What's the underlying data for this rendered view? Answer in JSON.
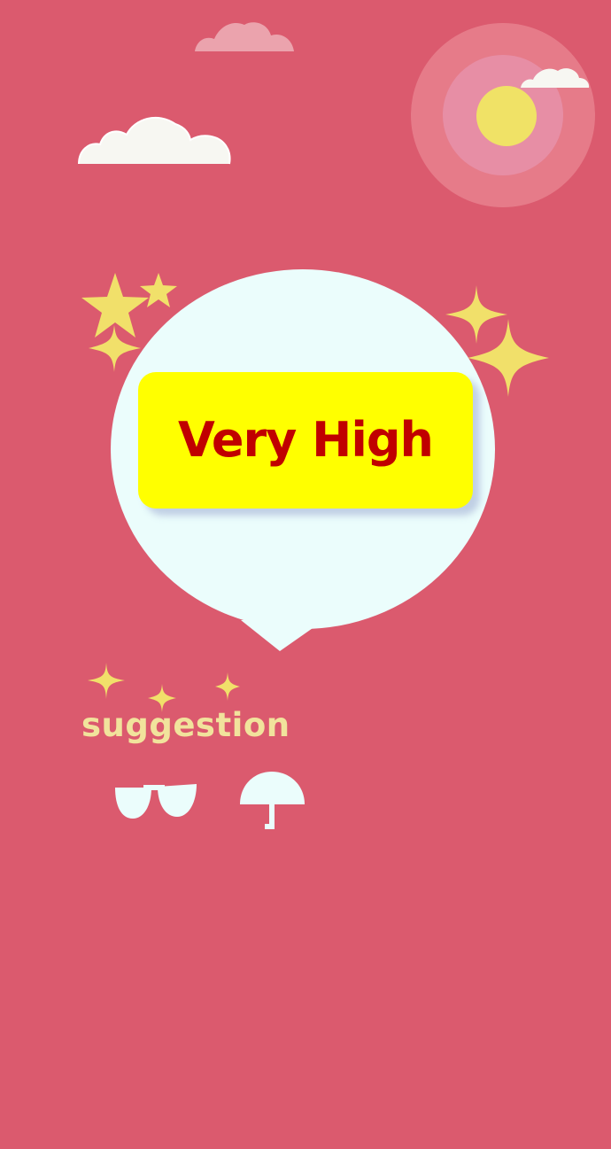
{
  "rating": {
    "level_text": "Very High"
  },
  "suggestion": {
    "label": "suggestion",
    "items": [
      {
        "icon": "sunglasses-icon"
      },
      {
        "icon": "umbrella-icon"
      }
    ]
  },
  "colors": {
    "background": "#db5a6e",
    "bubble": "#ebfdfc",
    "rating_box": "#ffff00",
    "rating_text": "#c00000",
    "sparkle": "#f1e06a",
    "suggestion_text": "#f1e39c",
    "sun": "#f0e266"
  }
}
